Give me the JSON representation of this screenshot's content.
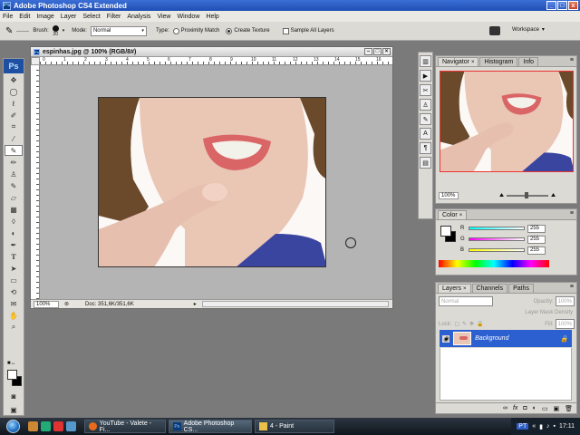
{
  "app": {
    "title": "Adobe Photoshop CS4 Extended",
    "icon_label": "Ps"
  },
  "window_controls": [
    "_",
    "□",
    "x"
  ],
  "menu": [
    "File",
    "Edit",
    "Image",
    "Layer",
    "Select",
    "Filter",
    "Analysis",
    "View",
    "Window",
    "Help"
  ],
  "options": {
    "brush_label": "Brush:",
    "brush_size": "20",
    "mode_label": "Mode:",
    "mode_value": "Normal",
    "type_label": "Type:",
    "type_options": [
      "Proximity Match",
      "Create Texture"
    ],
    "type_selected": "Create Texture",
    "sample_all_layers": "Sample All Layers",
    "workspace": "Workspace"
  },
  "document": {
    "title": "espinhas.jpg @ 100% (RGB/8#)",
    "ruler_h": [
      "0",
      "1",
      "2",
      "3",
      "4",
      "5",
      "6",
      "7",
      "8",
      "9",
      "10",
      "11",
      "12",
      "13",
      "14",
      "15",
      "16"
    ],
    "zoom": "100%",
    "doc_info": "Doc: 351,6K/351,6K"
  },
  "navigator": {
    "tabs": [
      "Navigator",
      "Histogram",
      "Info"
    ],
    "zoom": "100%"
  },
  "color": {
    "tabs": [
      "Color"
    ],
    "channels": [
      {
        "label": "R",
        "value": "255"
      },
      {
        "label": "G",
        "value": "255"
      },
      {
        "label": "B",
        "value": "255"
      }
    ]
  },
  "layers": {
    "tabs": [
      "Layers",
      "Channels",
      "Paths"
    ],
    "blend_mode": "Normal",
    "opacity_label": "Opacity:",
    "opacity": "100%",
    "layer_mask_density": "Layer Mask Density",
    "lock_label": "Lock:",
    "fill_label": "Fill:",
    "fill": "100%",
    "items": [
      {
        "name": "Background"
      }
    ]
  },
  "taskbar": {
    "tasks": [
      {
        "label": "YouTube - Valete - Fi..."
      },
      {
        "label": "Adobe Photoshop CS..."
      },
      {
        "label": "4 - Paint"
      }
    ],
    "language": "PT",
    "clock": "17:11"
  }
}
